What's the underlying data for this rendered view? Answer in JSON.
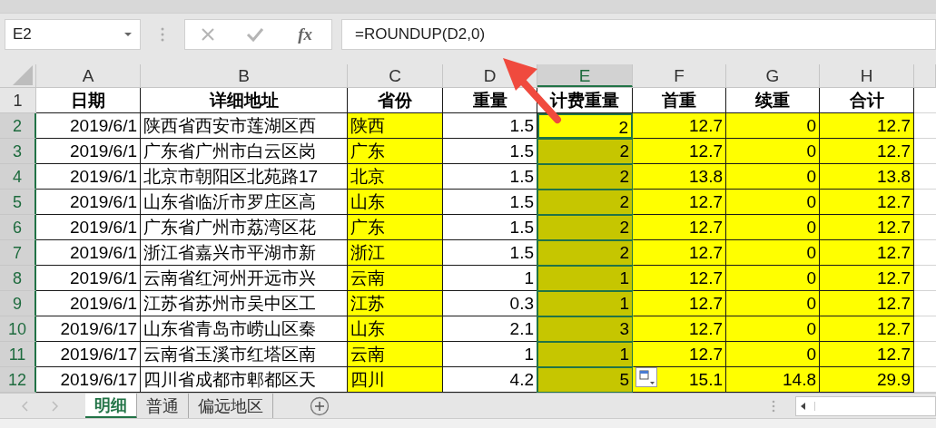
{
  "name_box": {
    "value": "E2"
  },
  "formula_bar": {
    "function_label": "fx",
    "value": "=ROUNDUP(D2,0)"
  },
  "columns": [
    {
      "label": "A",
      "selected": false,
      "filled": false,
      "numeric": true
    },
    {
      "label": "B",
      "selected": false,
      "filled": false,
      "numeric": false
    },
    {
      "label": "C",
      "selected": false,
      "filled": true,
      "numeric": false
    },
    {
      "label": "D",
      "selected": false,
      "filled": false,
      "numeric": true
    },
    {
      "label": "E",
      "selected": true,
      "filled": true,
      "numeric": true
    },
    {
      "label": "F",
      "selected": false,
      "filled": true,
      "numeric": true
    },
    {
      "label": "G",
      "selected": false,
      "filled": true,
      "numeric": true
    },
    {
      "label": "H",
      "selected": false,
      "filled": true,
      "numeric": true
    }
  ],
  "rows": [
    {
      "number": "1",
      "kind": "header",
      "selected": false,
      "active": false,
      "cells": [
        "日期",
        "详细地址",
        "省份",
        "重量",
        "计费重量",
        "首重",
        "续重",
        "合计"
      ]
    },
    {
      "number": "2",
      "kind": "data",
      "selected": true,
      "active": true,
      "cells": [
        "2019/6/1",
        "陕西省西安市莲湖区西",
        "陕西",
        "1.5",
        "2",
        "12.7",
        "0",
        "12.7"
      ]
    },
    {
      "number": "3",
      "kind": "data",
      "selected": true,
      "active": false,
      "cells": [
        "2019/6/1",
        "广东省广州市白云区岗",
        "广东",
        "1.5",
        "2",
        "12.7",
        "0",
        "12.7"
      ]
    },
    {
      "number": "4",
      "kind": "data",
      "selected": true,
      "active": false,
      "cells": [
        "2019/6/1",
        "北京市朝阳区北苑路17",
        "北京",
        "1.5",
        "2",
        "13.8",
        "0",
        "13.8"
      ]
    },
    {
      "number": "5",
      "kind": "data",
      "selected": true,
      "active": false,
      "cells": [
        "2019/6/1",
        "山东省临沂市罗庄区高",
        "山东",
        "1.5",
        "2",
        "12.7",
        "0",
        "12.7"
      ]
    },
    {
      "number": "6",
      "kind": "data",
      "selected": true,
      "active": false,
      "cells": [
        "2019/6/1",
        "广东省广州市荔湾区花",
        "广东",
        "1.5",
        "2",
        "12.7",
        "0",
        "12.7"
      ]
    },
    {
      "number": "7",
      "kind": "data",
      "selected": true,
      "active": false,
      "cells": [
        "2019/6/1",
        "浙江省嘉兴市平湖市新",
        "浙江",
        "1.5",
        "2",
        "12.7",
        "0",
        "12.7"
      ]
    },
    {
      "number": "8",
      "kind": "data",
      "selected": true,
      "active": false,
      "cells": [
        "2019/6/1",
        "云南省红河州开远市兴",
        "云南",
        "1",
        "1",
        "12.7",
        "0",
        "12.7"
      ]
    },
    {
      "number": "9",
      "kind": "data",
      "selected": true,
      "active": false,
      "cells": [
        "2019/6/1",
        "江苏省苏州市吴中区工",
        "江苏",
        "0.3",
        "1",
        "12.7",
        "0",
        "12.7"
      ]
    },
    {
      "number": "10",
      "kind": "data",
      "selected": true,
      "active": false,
      "cells": [
        "2019/6/17",
        "山东省青岛市崂山区秦",
        "山东",
        "2.1",
        "3",
        "12.7",
        "0",
        "12.7"
      ]
    },
    {
      "number": "11",
      "kind": "data",
      "selected": true,
      "active": false,
      "cells": [
        "2019/6/17",
        "云南省玉溪市红塔区南",
        "云南",
        "1",
        "1",
        "12.7",
        "0",
        "12.7"
      ]
    },
    {
      "number": "12",
      "kind": "data",
      "selected": true,
      "active": false,
      "cells": [
        "2019/6/17",
        "四川省成都市郫都区天",
        "四川",
        "4.2",
        "5",
        "15.1",
        "14.8",
        "29.9"
      ]
    }
  ],
  "sheet_tabs": [
    {
      "label": "明细",
      "selected": true
    },
    {
      "label": "普通",
      "selected": false
    },
    {
      "label": "偏远地区",
      "selected": false
    }
  ]
}
